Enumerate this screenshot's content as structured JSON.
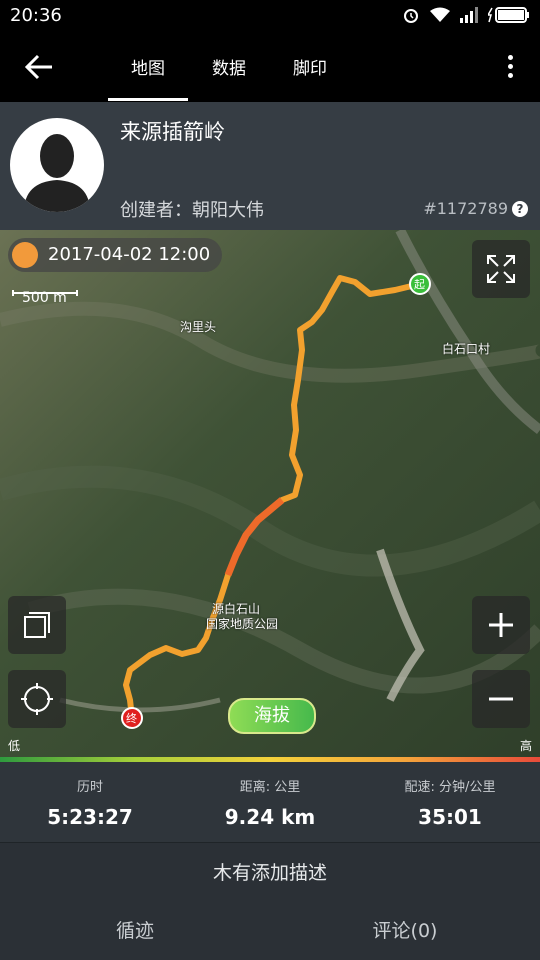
{
  "status": {
    "time": "20:36"
  },
  "tabs": [
    "地图",
    "数据",
    "脚印"
  ],
  "profile": {
    "title": "来源插箭岭",
    "creator": "创建者：朝阳大伟",
    "id": "#1172789",
    "help": "?"
  },
  "map": {
    "datetime": "2017-04-02 12:00",
    "scale": "500 m",
    "places": {
      "p1": "沟里头",
      "p2": "白石口村",
      "p3": "源白石山",
      "p4": "国家地质公园"
    },
    "start_marker": "起",
    "end_marker": "终",
    "altitude_button": "海拔",
    "legend_low": "低",
    "legend_high": "高"
  },
  "stats": [
    {
      "label": "历时",
      "value": "5:23:27"
    },
    {
      "label": "距离: 公里",
      "value": "9.24 km"
    },
    {
      "label": "配速: 分钟/公里",
      "value": "35:01"
    }
  ],
  "description": "木有添加描述",
  "bottom": {
    "track": "循迹",
    "comments": "评论(0)"
  },
  "colors": {
    "track": "#f2a12e",
    "start": "#3bbf3b",
    "end": "#e02020"
  }
}
